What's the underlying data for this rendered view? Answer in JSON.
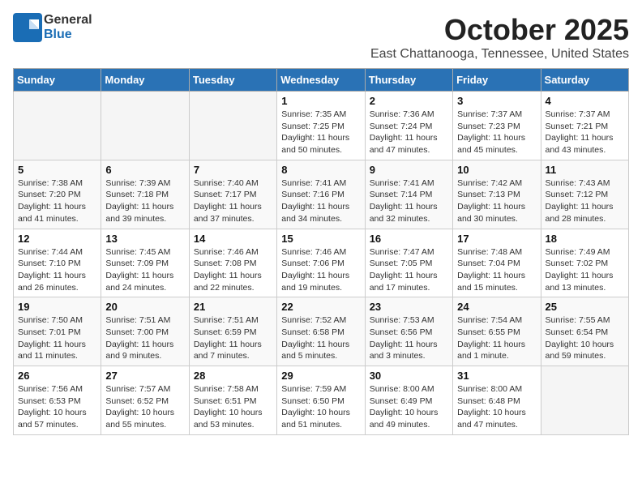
{
  "header": {
    "logo_general": "General",
    "logo_blue": "Blue",
    "month_title": "October 2025",
    "location": "East Chattanooga, Tennessee, United States"
  },
  "weekdays": [
    "Sunday",
    "Monday",
    "Tuesday",
    "Wednesday",
    "Thursday",
    "Friday",
    "Saturday"
  ],
  "weeks": [
    [
      {
        "day": "",
        "info": ""
      },
      {
        "day": "",
        "info": ""
      },
      {
        "day": "",
        "info": ""
      },
      {
        "day": "1",
        "info": "Sunrise: 7:35 AM\nSunset: 7:25 PM\nDaylight: 11 hours\nand 50 minutes."
      },
      {
        "day": "2",
        "info": "Sunrise: 7:36 AM\nSunset: 7:24 PM\nDaylight: 11 hours\nand 47 minutes."
      },
      {
        "day": "3",
        "info": "Sunrise: 7:37 AM\nSunset: 7:23 PM\nDaylight: 11 hours\nand 45 minutes."
      },
      {
        "day": "4",
        "info": "Sunrise: 7:37 AM\nSunset: 7:21 PM\nDaylight: 11 hours\nand 43 minutes."
      }
    ],
    [
      {
        "day": "5",
        "info": "Sunrise: 7:38 AM\nSunset: 7:20 PM\nDaylight: 11 hours\nand 41 minutes."
      },
      {
        "day": "6",
        "info": "Sunrise: 7:39 AM\nSunset: 7:18 PM\nDaylight: 11 hours\nand 39 minutes."
      },
      {
        "day": "7",
        "info": "Sunrise: 7:40 AM\nSunset: 7:17 PM\nDaylight: 11 hours\nand 37 minutes."
      },
      {
        "day": "8",
        "info": "Sunrise: 7:41 AM\nSunset: 7:16 PM\nDaylight: 11 hours\nand 34 minutes."
      },
      {
        "day": "9",
        "info": "Sunrise: 7:41 AM\nSunset: 7:14 PM\nDaylight: 11 hours\nand 32 minutes."
      },
      {
        "day": "10",
        "info": "Sunrise: 7:42 AM\nSunset: 7:13 PM\nDaylight: 11 hours\nand 30 minutes."
      },
      {
        "day": "11",
        "info": "Sunrise: 7:43 AM\nSunset: 7:12 PM\nDaylight: 11 hours\nand 28 minutes."
      }
    ],
    [
      {
        "day": "12",
        "info": "Sunrise: 7:44 AM\nSunset: 7:10 PM\nDaylight: 11 hours\nand 26 minutes."
      },
      {
        "day": "13",
        "info": "Sunrise: 7:45 AM\nSunset: 7:09 PM\nDaylight: 11 hours\nand 24 minutes."
      },
      {
        "day": "14",
        "info": "Sunrise: 7:46 AM\nSunset: 7:08 PM\nDaylight: 11 hours\nand 22 minutes."
      },
      {
        "day": "15",
        "info": "Sunrise: 7:46 AM\nSunset: 7:06 PM\nDaylight: 11 hours\nand 19 minutes."
      },
      {
        "day": "16",
        "info": "Sunrise: 7:47 AM\nSunset: 7:05 PM\nDaylight: 11 hours\nand 17 minutes."
      },
      {
        "day": "17",
        "info": "Sunrise: 7:48 AM\nSunset: 7:04 PM\nDaylight: 11 hours\nand 15 minutes."
      },
      {
        "day": "18",
        "info": "Sunrise: 7:49 AM\nSunset: 7:02 PM\nDaylight: 11 hours\nand 13 minutes."
      }
    ],
    [
      {
        "day": "19",
        "info": "Sunrise: 7:50 AM\nSunset: 7:01 PM\nDaylight: 11 hours\nand 11 minutes."
      },
      {
        "day": "20",
        "info": "Sunrise: 7:51 AM\nSunset: 7:00 PM\nDaylight: 11 hours\nand 9 minutes."
      },
      {
        "day": "21",
        "info": "Sunrise: 7:51 AM\nSunset: 6:59 PM\nDaylight: 11 hours\nand 7 minutes."
      },
      {
        "day": "22",
        "info": "Sunrise: 7:52 AM\nSunset: 6:58 PM\nDaylight: 11 hours\nand 5 minutes."
      },
      {
        "day": "23",
        "info": "Sunrise: 7:53 AM\nSunset: 6:56 PM\nDaylight: 11 hours\nand 3 minutes."
      },
      {
        "day": "24",
        "info": "Sunrise: 7:54 AM\nSunset: 6:55 PM\nDaylight: 11 hours\nand 1 minute."
      },
      {
        "day": "25",
        "info": "Sunrise: 7:55 AM\nSunset: 6:54 PM\nDaylight: 10 hours\nand 59 minutes."
      }
    ],
    [
      {
        "day": "26",
        "info": "Sunrise: 7:56 AM\nSunset: 6:53 PM\nDaylight: 10 hours\nand 57 minutes."
      },
      {
        "day": "27",
        "info": "Sunrise: 7:57 AM\nSunset: 6:52 PM\nDaylight: 10 hours\nand 55 minutes."
      },
      {
        "day": "28",
        "info": "Sunrise: 7:58 AM\nSunset: 6:51 PM\nDaylight: 10 hours\nand 53 minutes."
      },
      {
        "day": "29",
        "info": "Sunrise: 7:59 AM\nSunset: 6:50 PM\nDaylight: 10 hours\nand 51 minutes."
      },
      {
        "day": "30",
        "info": "Sunrise: 8:00 AM\nSunset: 6:49 PM\nDaylight: 10 hours\nand 49 minutes."
      },
      {
        "day": "31",
        "info": "Sunrise: 8:00 AM\nSunset: 6:48 PM\nDaylight: 10 hours\nand 47 minutes."
      },
      {
        "day": "",
        "info": ""
      }
    ]
  ]
}
